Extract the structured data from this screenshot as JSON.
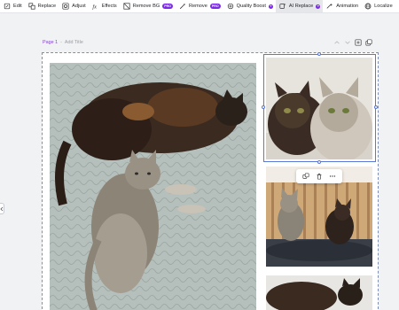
{
  "toolbar": {
    "items": [
      {
        "label": "Edit",
        "icon": "edit-icon"
      },
      {
        "label": "Replace",
        "icon": "replace-icon"
      },
      {
        "label": "Adjust",
        "icon": "adjust-icon"
      },
      {
        "label": "Effects",
        "icon": "effects-icon"
      },
      {
        "label": "Remove BG",
        "icon": "remove-bg-icon",
        "badge": "PRO"
      },
      {
        "label": "Remove",
        "icon": "remove-wand-icon",
        "badge": "PRO"
      },
      {
        "label": "Quality Boost",
        "icon": "quality-boost-icon",
        "dot": "✦"
      },
      {
        "label": "AI Replace",
        "icon": "ai-replace-icon",
        "dot": "✦",
        "active": true
      },
      {
        "label": "Animation",
        "icon": "animation-icon"
      },
      {
        "label": "Localize",
        "icon": "localize-icon"
      }
    ]
  },
  "page": {
    "label": "Page 1",
    "separator": "-",
    "add_title": "Add Title"
  },
  "colors": {
    "accent": "#7c2ae8",
    "selection": "#5a78d6",
    "page_label": "#8b3fd9"
  }
}
